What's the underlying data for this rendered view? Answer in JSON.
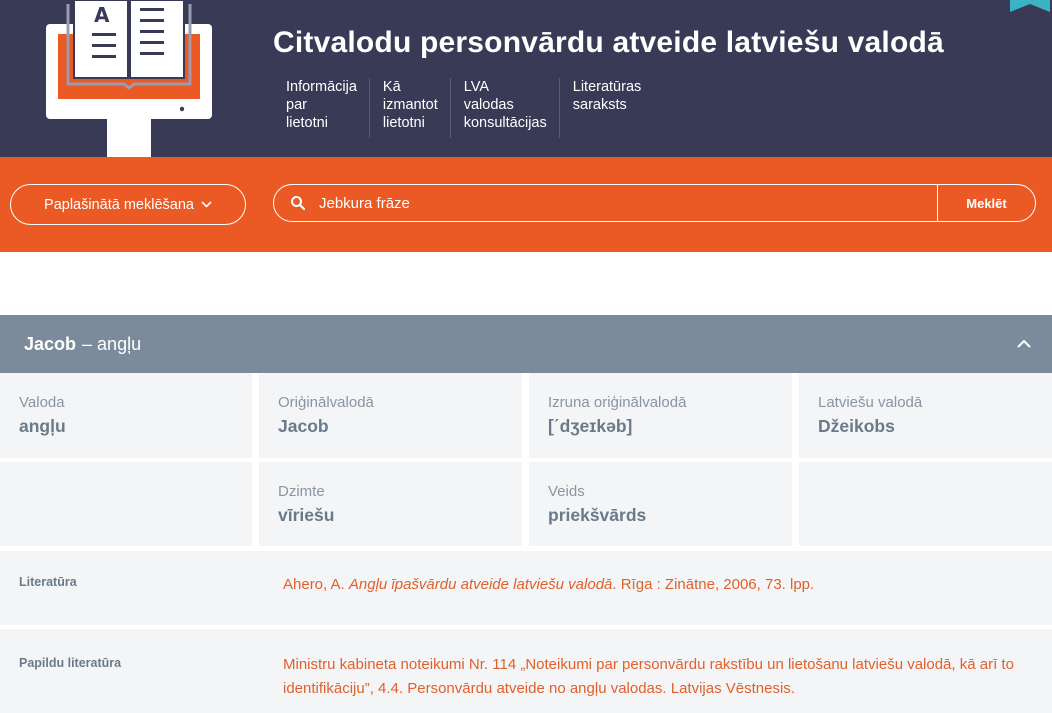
{
  "header": {
    "title": "Citvalodu personvārdu atveide latviešu valodā",
    "nav": [
      {
        "label": "Informācija\npar\nlietotni"
      },
      {
        "label": "Kā\nizmantot\nlietotni"
      },
      {
        "label": "LVA\nvalodas\nkonsultācijas"
      },
      {
        "label": "Literatūras\nsaraksts"
      }
    ]
  },
  "search": {
    "advanced_label": "Paplašinātā meklēšana",
    "placeholder": "Jebkura frāze",
    "button_label": "Meklēt"
  },
  "entry": {
    "name": "Jacob",
    "language_suffix": "– angļu",
    "fields": [
      {
        "label": "Valoda",
        "value": "angļu"
      },
      {
        "label": "Oriģinālvalodā",
        "value": "Jacob"
      },
      {
        "label": "Izruna oriģinālvalodā",
        "value": "[ˊdʒeɪkəb]"
      },
      {
        "label": "Latviešu valodā",
        "value": "Džeikobs"
      },
      {
        "label": "Dzimte",
        "value": "vīriešu"
      },
      {
        "label": "Veids",
        "value": "priekšvārds"
      }
    ]
  },
  "literature": {
    "label": "Literatūra",
    "text_before": "Ahero, A. ",
    "text_italic": "Angļu īpašvārdu atveide latviešu valodā",
    "text_after": ". Rīga : Zinātne, 2006, 73. lpp."
  },
  "extra_literature": {
    "label": "Papildu literatūra",
    "text": "Ministru kabineta noteikumi Nr. 114 „Noteikumi par personvārdu rakstību un lietošanu latviešu valodā, kā arī to identifikāciju”, 4.4. Personvārdu atveide no angļu valodas. Latvijas Vēstnesis."
  },
  "colors": {
    "header_bg": "#383a56",
    "accent": "#eb5a24",
    "entry_bar": "#7b8b9c",
    "link": "#e2602c"
  }
}
